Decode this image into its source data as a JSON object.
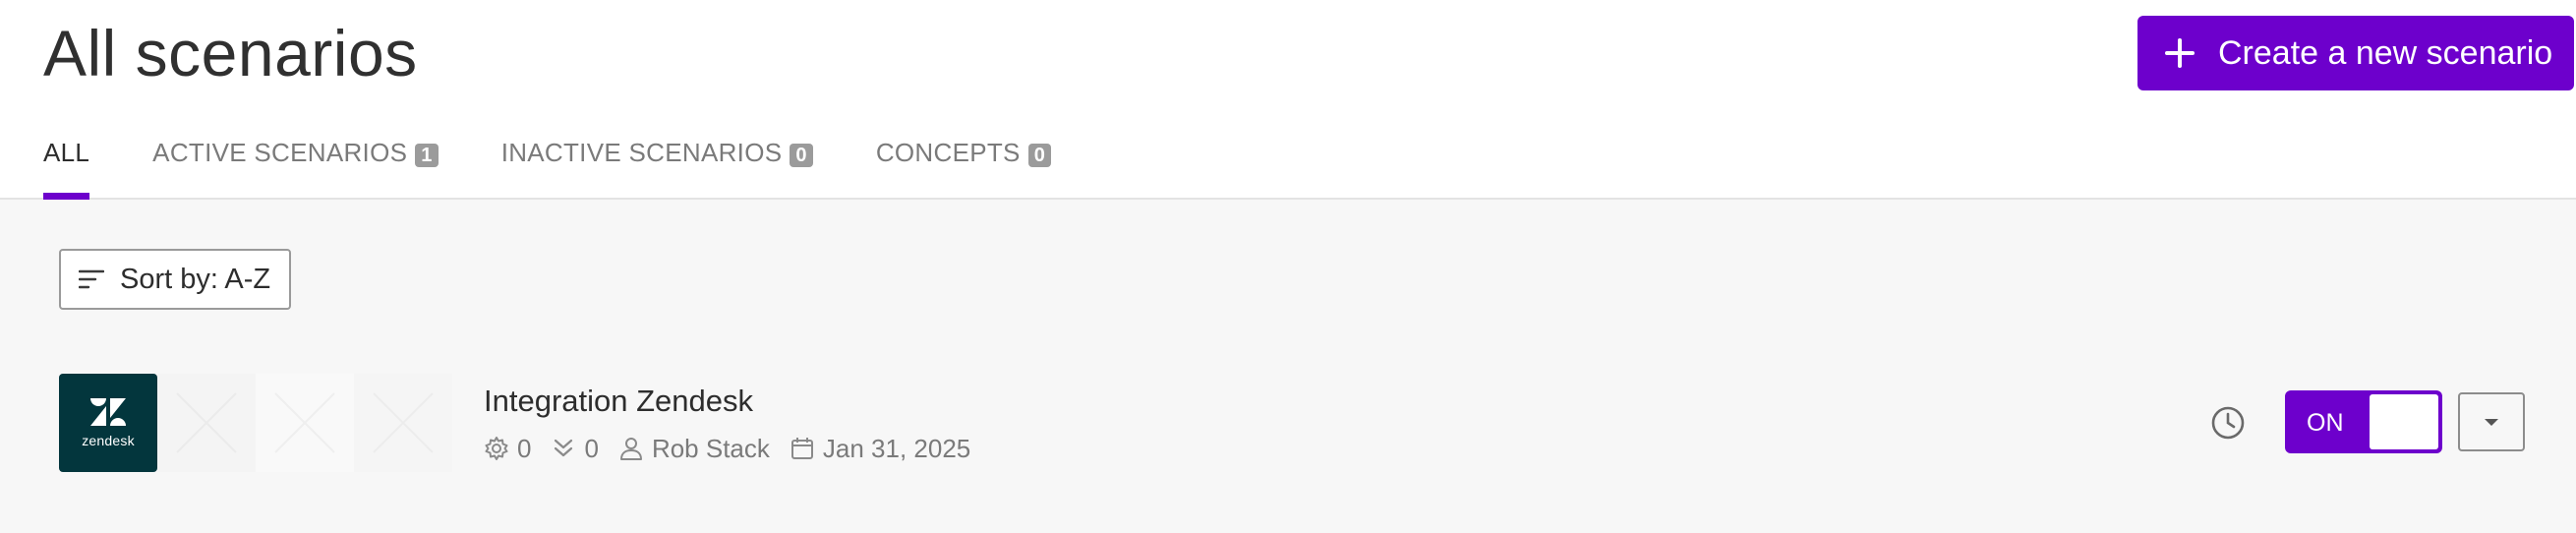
{
  "header": {
    "title": "All scenarios",
    "create_button_label": "Create a new scenario"
  },
  "tabs": [
    {
      "label": "ALL",
      "count": "",
      "active": true
    },
    {
      "label": "ACTIVE SCENARIOS",
      "count": "1",
      "active": false
    },
    {
      "label": "INACTIVE SCENARIOS",
      "count": "0",
      "active": false
    },
    {
      "label": "CONCEPTS",
      "count": "0",
      "active": false
    }
  ],
  "toolbar": {
    "sort_label": "Sort by: A-Z"
  },
  "scenarios": [
    {
      "app_logo_text": "zendesk",
      "name": "Integration Zendesk",
      "operations": "0",
      "data_transfer": "0",
      "owner": "Rob Stack",
      "date": "Jan 31, 2025",
      "status_label": "ON"
    }
  ],
  "colors": {
    "accent": "#6d00cc",
    "zendesk_brand": "#03363d"
  },
  "icons": {
    "create": "plus-icon",
    "sort": "sort-lines-icon",
    "operations": "gear-icon",
    "data_transfer": "double-chevron-down-icon",
    "owner": "user-icon",
    "date": "calendar-icon",
    "history": "clock-icon",
    "menu": "caret-down-icon"
  }
}
